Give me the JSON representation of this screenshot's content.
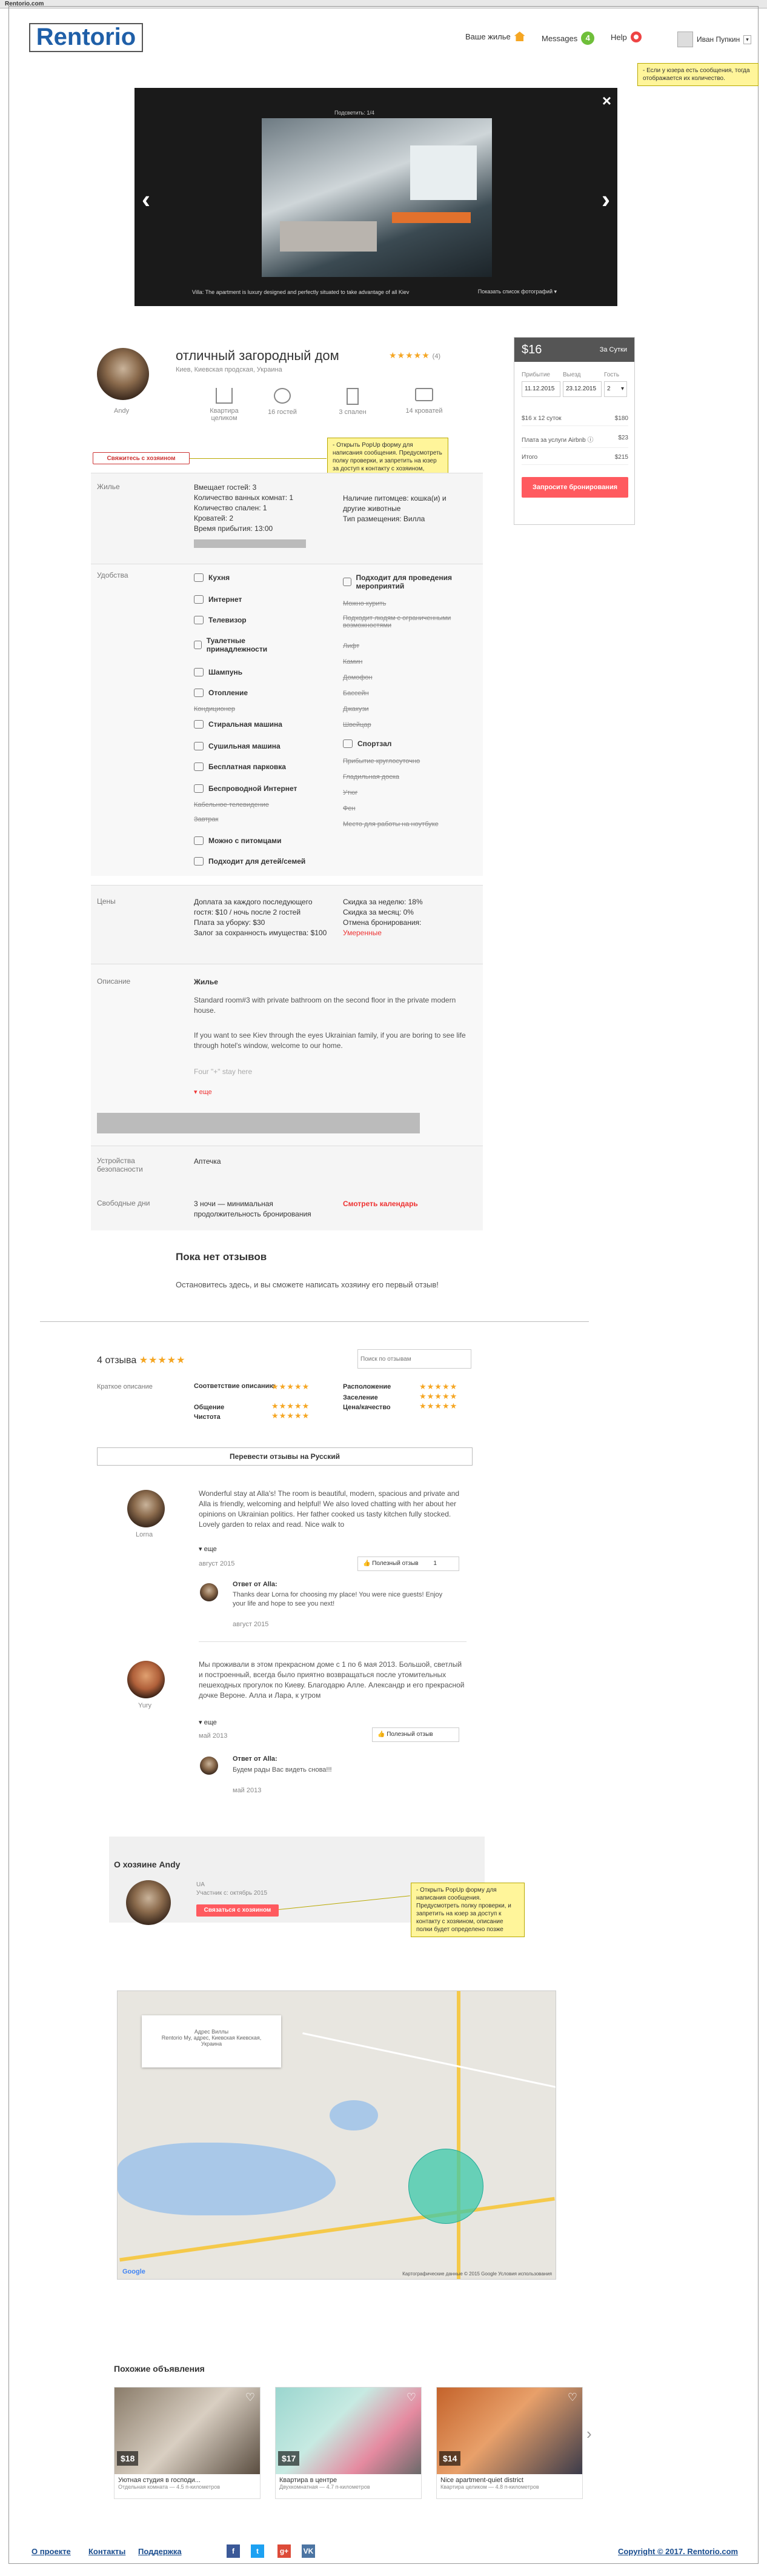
{
  "browser": {
    "url": "Rentorio.com"
  },
  "header": {
    "logo": "Rentorio",
    "my_housing": "Ваше жилье",
    "messages": "Messages",
    "messages_count": "4",
    "help": "Help",
    "user_name": "Иван Пупкин"
  },
  "notes": {
    "messages": "- Если у юзера есть сообщения, тогда отображается их количество.",
    "contact": "- Открыть PopUp форму для написания сообщения. Предусмотреть полку проверки, и запретить на юзер за доступ к контакту с хозяином, описание полки будет определено позже",
    "host_contact": "- Открыть PopUp форму для написания сообщения. Предусмотреть полку проверки, и запретить на юзер за доступ к контакту с хозяином, описание полки будет определено позже"
  },
  "gallery": {
    "close": "×",
    "prev": "‹",
    "next": "›",
    "counter": "Подсветить: 1/4",
    "caption": "Villa: The apartment is luxury designed and perfectly situated to take advantage of all Kiev",
    "show_list": "Показать список фотографий ▾"
  },
  "listing": {
    "title": "отличный загородный дом",
    "rating_stars": "★★★★★",
    "rating_count": "(4)",
    "location": "Киев, Киевская продская, Украина",
    "host_name": "Andy",
    "features": [
      {
        "label": "Квартира целиком"
      },
      {
        "label": "16 гостей"
      },
      {
        "label": "3 спален"
      },
      {
        "label": "14 кроватей"
      }
    ],
    "contact_button": "Свяжитесь с хозяином"
  },
  "housing": {
    "label": "Жилье",
    "left": [
      "Вмещает гостей: 3",
      "Количество ванных комнат: 1",
      "Количество спален: 1",
      "Кроватей: 2",
      "Время прибытия: 13:00"
    ],
    "right": [
      "Наличие питомцев: кошка(и) и другие животные",
      "Тип размещения: Вилла"
    ]
  },
  "amenities": {
    "label": "Удобства",
    "left": [
      "Кухня",
      "Интернет",
      "Телевизор",
      "Туалетные принадлежности",
      "Шампунь",
      "Отопление",
      "Стиральная машина",
      "Сушильная машина",
      "Бесплатная парковка",
      "Беспроводной Интернет",
      "Можно с питомцами",
      "Подходит для детей/семей"
    ],
    "left_strike": [
      "Кондиционер",
      "Кабельное телевидение",
      "Завтрак"
    ],
    "right": [
      "Подходит для проведения мероприятий",
      "Спортзал"
    ],
    "right_strike": [
      "Можно курить",
      "Подходит людям с ограниченными возможностями",
      "Лифт",
      "Камин",
      "Домофон",
      "Бассейн",
      "Джакузи",
      "Швейцар",
      "Прибытие круглосуточно",
      "Гладильная доска",
      "Утюг",
      "Фен",
      "Место для работы на ноутбуке"
    ]
  },
  "prices": {
    "label": "Цены",
    "left": [
      "Доплата за каждого последующего гостя: $10 / ночь после 2 гостей",
      "Плата за уборку: $30",
      "Залог за сохранность имущества: $100"
    ],
    "right": [
      "Скидка за неделю: 18%",
      "Скидка за месяц: 0%",
      "Отмена бронирования:"
    ],
    "cancel_policy": "Умеренные"
  },
  "description": {
    "label": "Описание",
    "title": "Жилье",
    "p1": "Standard room#3 with private bathroom on the second floor in the private modern house.",
    "p2": "If you want to see Kiev through the eyes Ukrainian family, if you are boring to see life through hotel's window, welcome to our home.",
    "p3": "Four \"+\" stay here",
    "more": "▾ еще"
  },
  "safety": {
    "label": "Устройства безопасности",
    "value": "Аптечка"
  },
  "availability": {
    "label": "Свободные дни",
    "value": "3 ночи — минимальная продолжительность бронирования",
    "calendar": "Смотреть календарь"
  },
  "no_reviews": {
    "title": "Пока нет отзывов",
    "text": "Остановитесь здесь, и вы сможете написать хозяину его первый отзыв!"
  },
  "reviews": {
    "count": "4 отзыва",
    "stars": "★★★★★",
    "search_placeholder": "Поиск по отзывам",
    "summary_label": "Краткое описание",
    "criteria": [
      [
        "Соответствие описанию",
        "★★★★★"
      ],
      [
        "Общение",
        "★★★★★"
      ],
      [
        "Чистота",
        "★★★★★"
      ],
      [
        "Расположение",
        "★★★★★"
      ],
      [
        "Заселение",
        "★★★★★"
      ],
      [
        "Цена/качество",
        "★★★★★"
      ]
    ],
    "translate": "Перевести отзывы на Русский",
    "items": [
      {
        "name": "Lorna",
        "text": "Wonderful stay at Alla's! The room is beautiful, modern, spacious and private and Alla is friendly, welcoming and helpful! We also loved chatting with her about her opinions on Ukrainian politics. Her father cooked us tasty kitchen fully stocked. Lovely garden to relax and read. Nice walk to",
        "more": "▾ еще",
        "date": "август 2015",
        "helpful": "Полезный отзыв",
        "helpful_count": "1",
        "reply_title": "Ответ от Alla:",
        "reply": "Thanks dear Lorna for choosing my place! You were nice guests! Enjoy your life and hope to see you next!",
        "reply_date": "август 2015"
      },
      {
        "name": "Yury",
        "text": "Мы проживали в этом прекрасном доме с 1 по 6 мая 2013. Большой, светлый и построенный, всегда было приятно возвращаться после утомительных пешеходных прогулок по Киеву. Благодарю Алле. Александр и его прекрасной дочке Вероне. Алла и Лара, к утром",
        "more": "▾ еще",
        "date": "май 2013",
        "helpful": "Полезный отзыв",
        "helpful_count": "",
        "reply_title": "Ответ от Alla:",
        "reply": "Будем рады Вас видеть снова!!!",
        "reply_date": "май 2013"
      }
    ]
  },
  "host": {
    "title": "О хозяине Andy",
    "country": "UA",
    "since": "Участник с: октябрь 2015",
    "contact": "Связаться с хозяином"
  },
  "map": {
    "address_title": "Адрес Виллы",
    "address": "Rentorio My, адрес, Киевская Киевская, Украина",
    "google": "Google",
    "terms": "Картографические данные © 2015 Google   Условия использования"
  },
  "similar": {
    "title": "Похожие объявления",
    "items": [
      {
        "price": "$18",
        "title": "Уютная студия в господи...",
        "sub": "Отдельная комната — 4.5 п-километров"
      },
      {
        "price": "$17",
        "title": "Квартира в центре",
        "sub": "Двухкомнатная — 4.7 п-километров"
      },
      {
        "price": "$14",
        "title": "Nice apartment-quiet district",
        "sub": "Квартира целиком — 4.8 п-километров"
      }
    ],
    "next": "›"
  },
  "booking": {
    "price": "$16",
    "period": "За Сутки",
    "checkin_label": "Прибытие",
    "checkout_label": "Выезд",
    "guests_label": "Гость",
    "checkin": "11.12.2015",
    "checkout": "23.12.2015",
    "guests": "2",
    "rows": [
      [
        "$16 x 12 суток",
        "$180"
      ],
      [
        "Плата за услуги Airbnb ⓘ",
        "$23"
      ],
      [
        "Итого",
        "$215"
      ]
    ],
    "button": "Запросите бронирования"
  },
  "footer": {
    "about": "О проекте",
    "contacts": "Контакты",
    "support": "Поддержка",
    "copyright": "Copyright © 2017. Rentorio.com"
  },
  "social": [
    {
      "name": "f",
      "color": "#3b5998"
    },
    {
      "name": "t",
      "color": "#1da1f2"
    },
    {
      "name": "g+",
      "color": "#dd4b39"
    },
    {
      "name": "VK",
      "color": "#4c75a3"
    }
  ]
}
